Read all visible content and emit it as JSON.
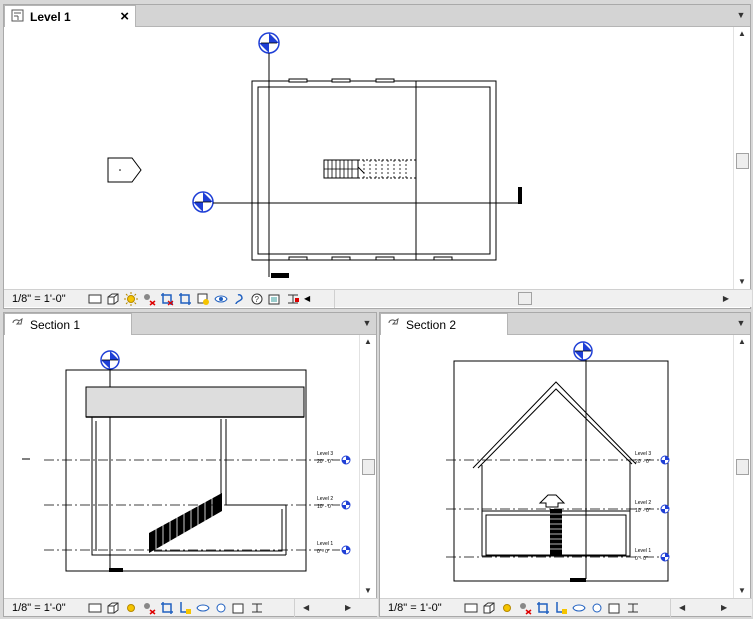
{
  "views": {
    "top": {
      "tab_label": "Level 1",
      "scale": "1/8\" = 1'-0\""
    },
    "left": {
      "tab_label": "Section 1",
      "scale": "1/8\" = 1'-0\""
    },
    "right": {
      "tab_label": "Section 2",
      "scale": "1/8\" = 1'-0\""
    }
  },
  "icons": {
    "close": "close-icon",
    "view_tab": "floor-plan-icon",
    "section_tab": "section-view-icon",
    "statusbar": [
      "detail-level-icon",
      "visual-style-icon",
      "sun-path-icon",
      "shadows-icon",
      "crop-view-icon",
      "show-crop-region-icon",
      "temporary-hide-icon",
      "reveal-hidden-icon",
      "lock-3d-icon",
      "analytical-model-icon",
      "highlight-displacement-icon",
      "constraints-icon"
    ]
  },
  "section_levels": {
    "level3": {
      "name": "Level 3",
      "elev": "20' - 0\""
    },
    "level2": {
      "name": "Level 2",
      "elev": "10' - 0\""
    },
    "level1": {
      "name": "Level 1",
      "elev": "0' - 0\""
    }
  },
  "colors": {
    "accent": "#1f3fd6",
    "tabbar": "#d4d4d4"
  }
}
